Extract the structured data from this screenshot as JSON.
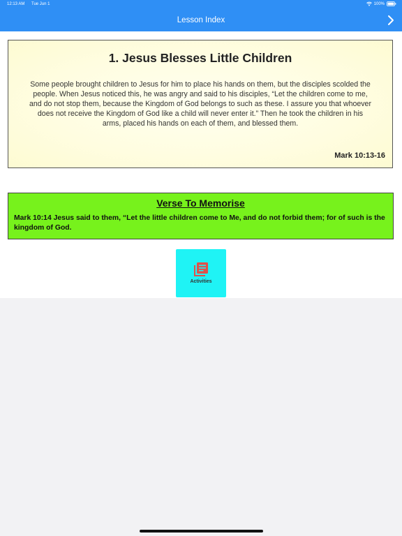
{
  "status_bar": {
    "time": "12:13 AM",
    "date": "Tue Jun 1",
    "battery": "100%",
    "icons": [
      "wifi-icon",
      "battery-icon"
    ]
  },
  "nav": {
    "title": "Lesson Index",
    "next_icon": "chevron-right-icon"
  },
  "lesson": {
    "title": "1. Jesus Blesses Little Children",
    "text": "Some people brought children to Jesus for him to place his hands on them, but the disciples scolded the people. When Jesus noticed this, he was angry and said to his disciples, “Let the children come to me, and do not stop them, because the Kingdom of God belongs to such as these. I assure you that whoever does not receive the Kingdom of God like a child will never enter it.” Then he took the children in his arms, placed his hands on each of them, and blessed them.",
    "reference": "Mark 10:13-16"
  },
  "verse": {
    "title": "Verse To Memorise",
    "text": "Mark 10:14 Jesus said to them, “Let the little children come to Me, and do not forbid them; for of such is the kingdom of God."
  },
  "activities": {
    "label": "Activities",
    "icon": "library-books-icon"
  },
  "colors": {
    "header": "#2f8ff5",
    "verse_background": "#77f21c",
    "activities_background": "#1ff3f5",
    "activities_icon": "#e0514a"
  }
}
